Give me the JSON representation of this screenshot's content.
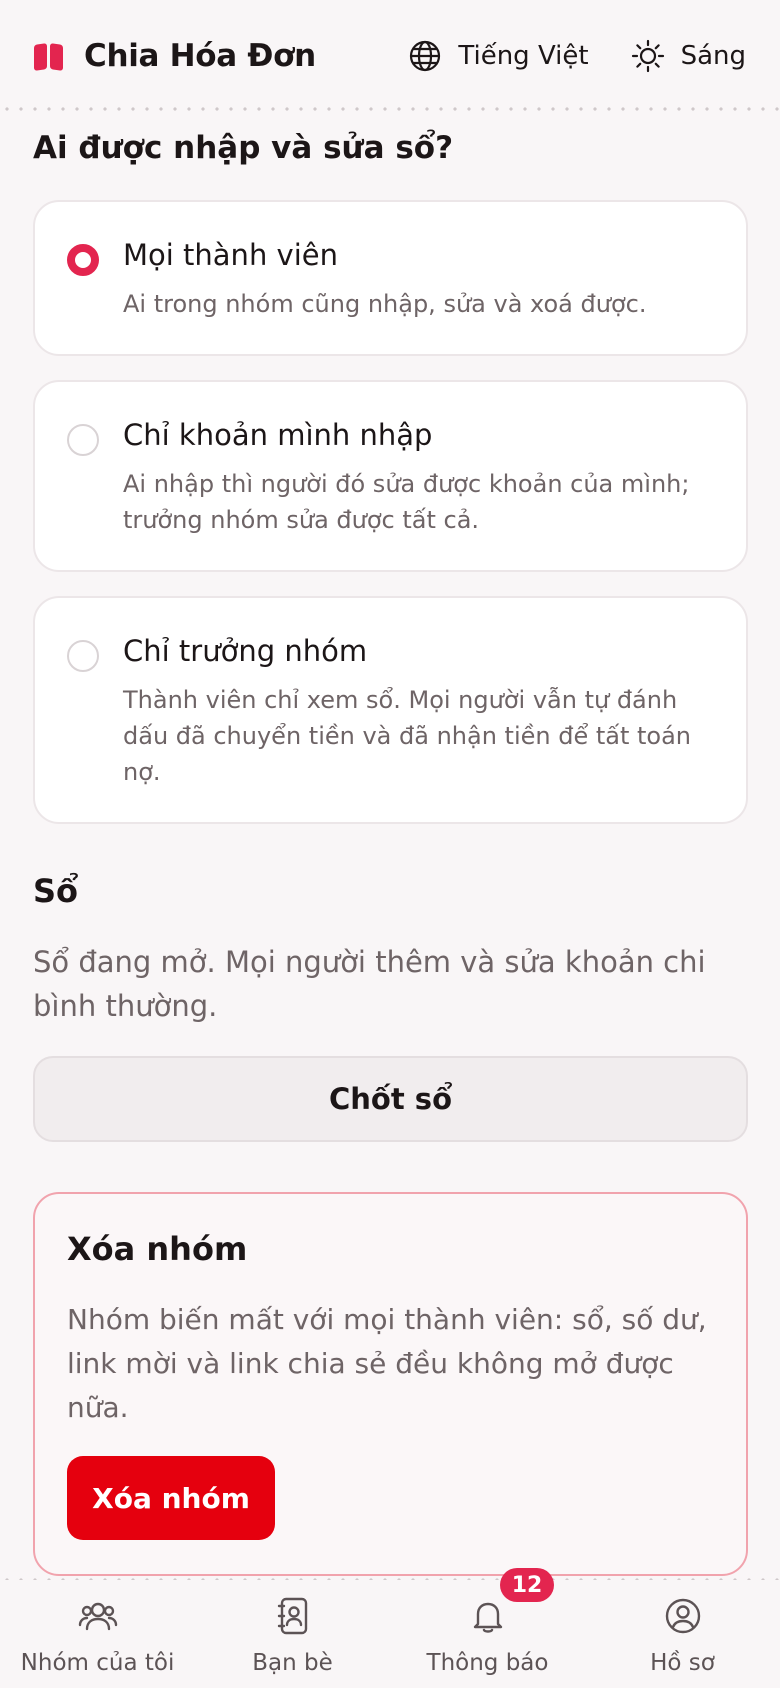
{
  "app": {
    "title": "Chia Hóa Đơn",
    "icon": "receipt-logo-icon",
    "accent_color": "#e3254f"
  },
  "header": {
    "language_label": "Tiếng Việt",
    "language_icon": "globe-icon",
    "theme_label": "Sáng",
    "theme_icon": "sun-icon"
  },
  "permissions": {
    "title": "Ai được nhập và sửa sổ?",
    "options": [
      {
        "label": "Mọi thành viên",
        "description": "Ai trong nhóm cũng nhập, sửa và xoá được.",
        "selected": true
      },
      {
        "label": "Chỉ khoản mình nhập",
        "description": "Ai nhập thì người đó sửa được khoản của mình; trưởng nhóm sửa được tất cả.",
        "selected": false
      },
      {
        "label": "Chỉ trưởng nhóm",
        "description": "Thành viên chỉ xem sổ. Mọi người vẫn tự đánh dấu đã chuyển tiền và đã nhận tiền để tất toán nợ.",
        "selected": false
      }
    ]
  },
  "ledger": {
    "title": "Sổ",
    "status_text": "Sổ đang mở. Mọi người thêm và sửa khoản chi bình thường.",
    "close_button_label": "Chốt sổ"
  },
  "delete_group": {
    "title": "Xóa nhóm",
    "description": "Nhóm biến mất với mọi thành viên: sổ, số dư, link mời và link chia sẻ đều không mở được nữa.",
    "button_label": "Xóa nhóm",
    "button_color": "#e5000e"
  },
  "bottom_nav": {
    "items": [
      {
        "label": "Nhóm của tôi",
        "icon": "users-icon"
      },
      {
        "label": "Bạn bè",
        "icon": "contacts-icon"
      },
      {
        "label": "Thông báo",
        "icon": "bell-icon",
        "badge": "12"
      },
      {
        "label": "Hồ sơ",
        "icon": "profile-icon"
      }
    ]
  }
}
